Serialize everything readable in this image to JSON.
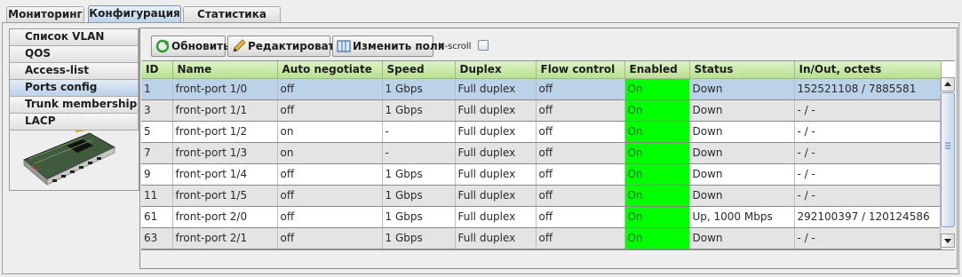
{
  "top_tabs": [
    "Мониторинг",
    "Конфигурация",
    "Статистика RRD"
  ],
  "active_top_tab": 1,
  "sidebar": {
    "items": [
      {
        "label": "Список VLAN"
      },
      {
        "label": "QOS"
      },
      {
        "label": "Access-list"
      },
      {
        "label": "Ports config"
      },
      {
        "label": "Trunk membership"
      },
      {
        "label": "LACP"
      }
    ],
    "active_index": 3
  },
  "toolbar": {
    "refresh_label": "Обновить",
    "edit_label": "Редактировать",
    "fields_label": "Изменить поля",
    "hscroll_label": "H-scroll",
    "hscroll_checked": false
  },
  "table": {
    "columns": [
      "ID",
      "Name",
      "Auto negotiate",
      "Speed",
      "Duplex",
      "Flow control",
      "Enabled",
      "Status",
      "In/Out, octets"
    ],
    "rows": [
      [
        "1",
        "front-port 1/0",
        "off",
        "1 Gbps",
        "Full duplex",
        "off",
        "On",
        "Down",
        "152521108 / 7885581"
      ],
      [
        "3",
        "front-port 1/1",
        "off",
        "1 Gbps",
        "Full duplex",
        "off",
        "On",
        "Down",
        "- / -"
      ],
      [
        "5",
        "front-port 1/2",
        "on",
        "-",
        "Full duplex",
        "off",
        "On",
        "Down",
        "- / -"
      ],
      [
        "7",
        "front-port 1/3",
        "on",
        "-",
        "Full duplex",
        "off",
        "On",
        "Down",
        "- / -"
      ],
      [
        "9",
        "front-port 1/4",
        "off",
        "1 Gbps",
        "Full duplex",
        "off",
        "On",
        "Down",
        "- / -"
      ],
      [
        "11",
        "front-port 1/5",
        "off",
        "1 Gbps",
        "Full duplex",
        "off",
        "On",
        "Down",
        "- / -"
      ],
      [
        "61",
        "front-port 2/0",
        "off",
        "1 Gbps",
        "Full duplex",
        "off",
        "On",
        "Up, 1000 Mbps",
        "292100397 / 120124586"
      ],
      [
        "63",
        "front-port 2/1",
        "off",
        "1 Gbps",
        "Full duplex",
        "off",
        "On",
        "Down",
        "- / -"
      ]
    ],
    "selected_row": 0
  },
  "colors": {
    "header_green": "#b8e090",
    "enabled_green": "#00ff00",
    "selected_row": "#bcd2e8",
    "alt_row": "#e4e4e4"
  }
}
